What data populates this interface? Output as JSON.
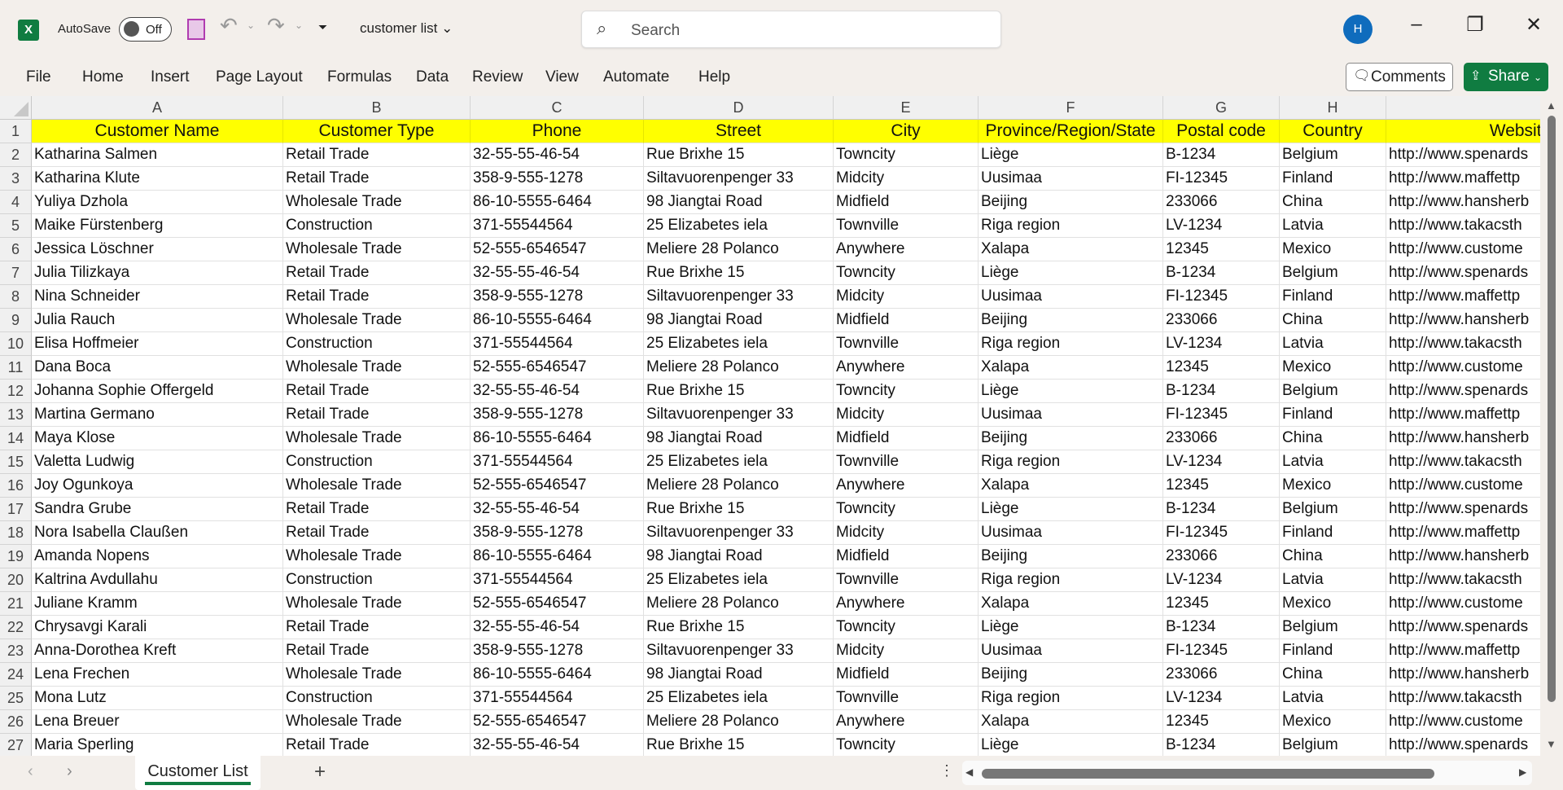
{
  "titlebar": {
    "app_icon": "excel-icon",
    "autosave_label": "AutoSave",
    "autosave_state": "Off",
    "document_title": "customer list",
    "search_placeholder": "Search",
    "avatar_initial": "H"
  },
  "menu": {
    "items": [
      "File",
      "Home",
      "Insert",
      "Page Layout",
      "Formulas",
      "Data",
      "Review",
      "View",
      "Automate",
      "Help"
    ],
    "comments_label": "Comments",
    "share_label": "Share"
  },
  "sheet": {
    "columns": [
      "A",
      "B",
      "C",
      "D",
      "E",
      "F",
      "G",
      "H",
      ""
    ],
    "header_row": [
      "Customer Name",
      "Customer Type",
      "Phone",
      "Street",
      "City",
      "Province/Region/State",
      "Postal code",
      "Country",
      "Website"
    ],
    "rows": [
      [
        "Katharina Salmen",
        "Retail Trade",
        "32-55-55-46-54",
        "Rue Brixhe 15",
        "Towncity",
        "Liège",
        "B-1234",
        "Belgium",
        "http://www.spenards"
      ],
      [
        "Katharina Klute",
        "Retail Trade",
        "358-9-555-1278",
        "Siltavuorenpenger 33",
        "Midcity",
        "Uusimaa",
        "FI-12345",
        "Finland",
        "http://www.maffettp"
      ],
      [
        "Yuliya Dzhola",
        "Wholesale Trade",
        "86-10-5555-6464",
        "98 Jiangtai Road",
        "Midfield",
        "Beijing",
        "233066",
        "China",
        "http://www.hansherb"
      ],
      [
        "Maike Fürstenberg",
        "Construction",
        "371-55544564",
        "25 Elizabetes iela",
        "Townville",
        "Riga region",
        "LV-1234",
        "Latvia",
        "http://www.takacsth"
      ],
      [
        "Jessica Löschner",
        "Wholesale Trade",
        "52-555-6546547",
        "Meliere 28 Polanco",
        "Anywhere",
        "Xalapa",
        "12345",
        "Mexico",
        "http://www.custome"
      ],
      [
        "Julia Tilizkaya",
        "Retail Trade",
        "32-55-55-46-54",
        "Rue Brixhe 15",
        "Towncity",
        "Liège",
        "B-1234",
        "Belgium",
        "http://www.spenards"
      ],
      [
        "Nina Schneider",
        "Retail Trade",
        "358-9-555-1278",
        "Siltavuorenpenger 33",
        "Midcity",
        "Uusimaa",
        "FI-12345",
        "Finland",
        "http://www.maffettp"
      ],
      [
        "Julia Rauch",
        "Wholesale Trade",
        "86-10-5555-6464",
        "98 Jiangtai Road",
        "Midfield",
        "Beijing",
        "233066",
        "China",
        "http://www.hansherb"
      ],
      [
        "Elisa Hoffmeier",
        "Construction",
        "371-55544564",
        "25 Elizabetes iela",
        "Townville",
        "Riga region",
        "LV-1234",
        "Latvia",
        "http://www.takacsth"
      ],
      [
        "Dana Boca",
        "Wholesale Trade",
        "52-555-6546547",
        "Meliere 28 Polanco",
        "Anywhere",
        "Xalapa",
        "12345",
        "Mexico",
        "http://www.custome"
      ],
      [
        "Johanna Sophie Offergeld",
        "Retail Trade",
        "32-55-55-46-54",
        "Rue Brixhe 15",
        "Towncity",
        "Liège",
        "B-1234",
        "Belgium",
        "http://www.spenards"
      ],
      [
        "Martina Germano",
        "Retail Trade",
        "358-9-555-1278",
        "Siltavuorenpenger 33",
        "Midcity",
        "Uusimaa",
        "FI-12345",
        "Finland",
        "http://www.maffettp"
      ],
      [
        "Maya Klose",
        "Wholesale Trade",
        "86-10-5555-6464",
        "98 Jiangtai Road",
        "Midfield",
        "Beijing",
        "233066",
        "China",
        "http://www.hansherb"
      ],
      [
        "Valetta Ludwig",
        "Construction",
        "371-55544564",
        "25 Elizabetes iela",
        "Townville",
        "Riga region",
        "LV-1234",
        "Latvia",
        "http://www.takacsth"
      ],
      [
        "Joy Ogunkoya",
        "Wholesale Trade",
        "52-555-6546547",
        "Meliere 28 Polanco",
        "Anywhere",
        "Xalapa",
        "12345",
        "Mexico",
        "http://www.custome"
      ],
      [
        "Sandra Grube",
        "Retail Trade",
        "32-55-55-46-54",
        "Rue Brixhe 15",
        "Towncity",
        "Liège",
        "B-1234",
        "Belgium",
        "http://www.spenards"
      ],
      [
        "Nora Isabella Claußen",
        "Retail Trade",
        "358-9-555-1278",
        "Siltavuorenpenger 33",
        "Midcity",
        "Uusimaa",
        "FI-12345",
        "Finland",
        "http://www.maffettp"
      ],
      [
        "Amanda Nopens",
        "Wholesale Trade",
        "86-10-5555-6464",
        "98 Jiangtai Road",
        "Midfield",
        "Beijing",
        "233066",
        "China",
        "http://www.hansherb"
      ],
      [
        "Kaltrina Avdullahu",
        "Construction",
        "371-55544564",
        "25 Elizabetes iela",
        "Townville",
        "Riga region",
        "LV-1234",
        "Latvia",
        "http://www.takacsth"
      ],
      [
        "Juliane Kramm",
        "Wholesale Trade",
        "52-555-6546547",
        "Meliere 28 Polanco",
        "Anywhere",
        "Xalapa",
        "12345",
        "Mexico",
        "http://www.custome"
      ],
      [
        "Chrysavgi Karali",
        "Retail Trade",
        "32-55-55-46-54",
        "Rue Brixhe 15",
        "Towncity",
        "Liège",
        "B-1234",
        "Belgium",
        "http://www.spenards"
      ],
      [
        "Anna-Dorothea Kreft",
        "Retail Trade",
        "358-9-555-1278",
        "Siltavuorenpenger 33",
        "Midcity",
        "Uusimaa",
        "FI-12345",
        "Finland",
        "http://www.maffettp"
      ],
      [
        "Lena Frechen",
        "Wholesale Trade",
        "86-10-5555-6464",
        "98 Jiangtai Road",
        "Midfield",
        "Beijing",
        "233066",
        "China",
        "http://www.hansherb"
      ],
      [
        "Mona Lutz",
        "Construction",
        "371-55544564",
        "25 Elizabetes iela",
        "Townville",
        "Riga region",
        "LV-1234",
        "Latvia",
        "http://www.takacsth"
      ],
      [
        "Lena Breuer",
        "Wholesale Trade",
        "52-555-6546547",
        "Meliere 28 Polanco",
        "Anywhere",
        "Xalapa",
        "12345",
        "Mexico",
        "http://www.custome"
      ],
      [
        "Maria Sperling",
        "Retail Trade",
        "32-55-55-46-54",
        "Rue Brixhe 15",
        "Towncity",
        "Liège",
        "B-1234",
        "Belgium",
        "http://www.spenards"
      ]
    ],
    "header_fill": "#ffff00"
  },
  "tabs": {
    "sheets": [
      "Customer List"
    ],
    "accent": "#107c41"
  }
}
